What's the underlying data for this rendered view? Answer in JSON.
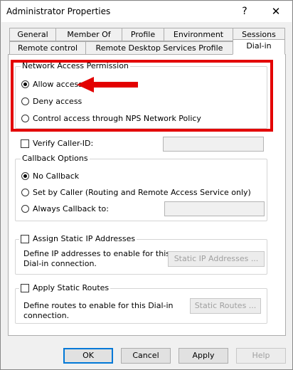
{
  "window": {
    "title": "Administrator Properties",
    "help_glyph": "?",
    "close_glyph": "✕"
  },
  "tabs": {
    "row1": [
      "General",
      "Member Of",
      "Profile",
      "Environment",
      "Sessions"
    ],
    "row2": [
      "Remote control",
      "Remote Desktop Services Profile",
      "Dial-in"
    ],
    "active": "Dial-in"
  },
  "network_access": {
    "legend": "Network Access Permission",
    "options": [
      "Allow access",
      "Deny access",
      "Control access through NPS Network Policy"
    ],
    "selected": "Allow access"
  },
  "verify_caller_id": {
    "label": "Verify Caller-ID:",
    "checked": false,
    "value": ""
  },
  "callback": {
    "legend": "Callback Options",
    "options": [
      "No Callback",
      "Set by Caller (Routing and Remote Access Service only)",
      "Always Callback to:"
    ],
    "selected": "No Callback",
    "always_value": ""
  },
  "static_ip": {
    "label": "Assign Static IP Addresses",
    "checked": false,
    "description": "Define IP addresses to enable for this Dial-in connection.",
    "desc_line1": "Define IP addresses to enable for this",
    "desc_line2": "Dial-in connection.",
    "button": "Static IP Addresses ..."
  },
  "static_routes": {
    "label": "Apply Static Routes",
    "checked": false,
    "desc_line1": "Define routes to enable for this Dial-in",
    "desc_line2": "connection.",
    "button": "Static Routes ..."
  },
  "footer": {
    "ok": "OK",
    "cancel": "Cancel",
    "apply": "Apply",
    "help": "Help"
  },
  "colors": {
    "highlight": "#e30000",
    "focus": "#0078d7"
  },
  "icons": {
    "arrow": "red-arrow-icon"
  }
}
